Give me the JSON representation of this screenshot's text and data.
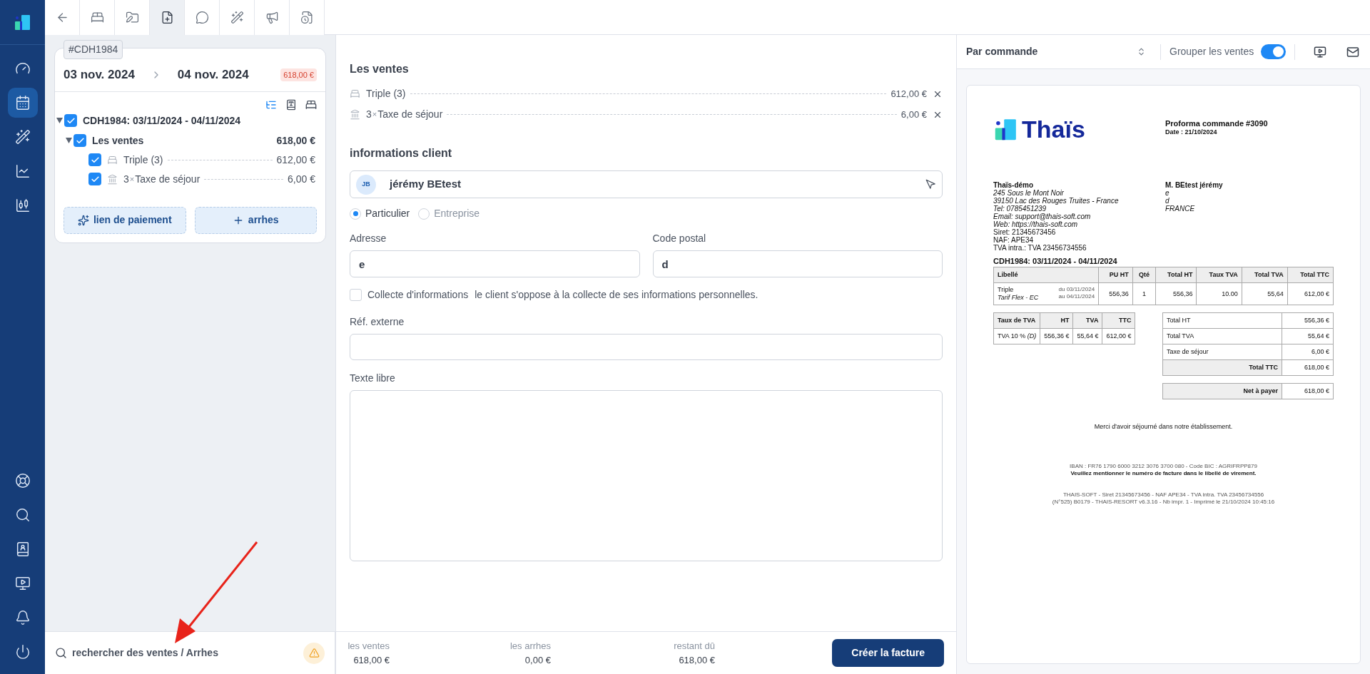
{
  "sidebar": {
    "items": [
      {
        "kind": "gauge",
        "selected": false
      },
      {
        "kind": "calendar",
        "selected": true
      },
      {
        "kind": "wand",
        "selected": false
      },
      {
        "kind": "chart",
        "selected": false
      },
      {
        "kind": "candles",
        "selected": false
      }
    ],
    "bottom_items": [
      {
        "kind": "lifebuoy"
      },
      {
        "kind": "search"
      },
      {
        "kind": "contacts"
      },
      {
        "kind": "monitor"
      },
      {
        "kind": "bell"
      },
      {
        "kind": "power"
      }
    ]
  },
  "tabs": [
    {
      "kind": "back",
      "selected": false
    },
    {
      "kind": "bed",
      "selected": false
    },
    {
      "kind": "folder",
      "selected": false
    },
    {
      "kind": "file-plus",
      "selected": true
    },
    {
      "kind": "message",
      "selected": false
    },
    {
      "kind": "wand",
      "selected": false
    },
    {
      "kind": "megaphone",
      "selected": false
    },
    {
      "kind": "file-clock",
      "selected": false
    }
  ],
  "booking": {
    "reference": "#CDH1984",
    "arrival": "03 nov. 2024",
    "departure": "04 nov. 2024",
    "balance": "618,00 €",
    "tree": {
      "label": "CDH1984: 03/11/2024 - 04/11/2024",
      "checked": true,
      "expanded": true,
      "children": [
        {
          "label": "Les ventes",
          "amount": "618,00 €",
          "checked": true,
          "expanded": true,
          "children": [
            {
              "kind": "room",
              "label": "Triple (3)",
              "amount": "612,00 €",
              "checked": true
            },
            {
              "kind": "tax",
              "quantity": "3",
              "multiplier": "×",
              "label": "Taxe de séjour",
              "amount": "6,00 €",
              "checked": true
            }
          ]
        }
      ]
    },
    "buttons": [
      {
        "kind": "sparkles",
        "label": "lien de paiement"
      },
      {
        "kind": "plus",
        "label": "arrhes"
      }
    ]
  },
  "search": {
    "placeholder": "rechercher des ventes / Arrhes"
  },
  "sales": {
    "title": "Les ventes",
    "items": [
      {
        "kind": "room",
        "label": "Triple (3)",
        "amount": "612,00 €"
      },
      {
        "kind": "tax",
        "quantity": "3",
        "multiplier": "×",
        "label": "Taxe de séjour",
        "amount": "6,00 €"
      }
    ]
  },
  "client": {
    "title": "informations client",
    "initials": "JB",
    "name": "jérémy BEtest",
    "types": [
      {
        "label": "Particulier",
        "selected": true
      },
      {
        "label": "Entreprise",
        "selected": false
      }
    ],
    "address": {
      "label": "Adresse",
      "value": "e"
    },
    "postal_code": {
      "label": "Code postal",
      "value": "d"
    },
    "consent": {
      "label": "Collecte d'informations",
      "description": "le client s'oppose à la collecte de ses informations personnelles.",
      "checked": false
    },
    "external_ref": {
      "label": "Réf. externe"
    },
    "free_text": {
      "label": "Texte libre"
    }
  },
  "totals": [
    {
      "label": "les ventes",
      "value": "618,00 €"
    },
    {
      "label": "les arrhes",
      "value": "0,00 €"
    },
    {
      "label": "restant dû",
      "value": "618,00 €"
    }
  ],
  "create_button": "Créer la facture",
  "preview": {
    "grouping": "Par commande",
    "group_sales": {
      "label": "Grouper les ventes",
      "on": true
    },
    "document": {
      "logo_text": "Thaïs",
      "title": "Proforma commande #3090",
      "date": "Date : 21/10/2024",
      "issuer": {
        "name": "Thaïs-démo",
        "lines": [
          {
            "text": "245 Sous le Mont Noir",
            "italic": true
          },
          {
            "text": "39150 Lac des Rouges Truites - France",
            "italic": true
          },
          {
            "text": "Tel: 0785451239",
            "italic": true
          },
          {
            "text": "Email: support@thais-soft.com",
            "italic": true
          },
          {
            "text": "Web: https://thais-soft.com",
            "italic": true
          },
          {
            "text": "Siret: 21345673456",
            "italic": false
          },
          {
            "text": "NAF: APE34",
            "italic": false
          },
          {
            "text": "TVA intra.: TVA 23456734556",
            "italic": false
          }
        ]
      },
      "recipient": {
        "name": "M. BEtest jérémy",
        "lines": [
          "e",
          "d",
          "FRANCE"
        ]
      },
      "order_title": "CDH1984: 03/11/2024 - 04/11/2024",
      "columns": [
        "Libellé",
        "PU HT",
        "Qté",
        "Total HT",
        "Taux TVA",
        "Total TVA",
        "Total TTC"
      ],
      "rows": [
        {
          "label": "Triple",
          "rate_name": "Tarif Flex - EC",
          "from": "du 03/11/2024",
          "to": "au 04/11/2024",
          "unit_price": "556,36",
          "quantity": "1",
          "total_ht": "556,36",
          "vat_rate": "10.00",
          "total_vat": "55,64",
          "total_ttc": "612,00 €"
        }
      ],
      "vat_columns": [
        "Taux de TVA",
        "HT",
        "TVA",
        "TTC"
      ],
      "vat_rows": [
        [
          "TVA 10 % *(D)*",
          "556,36 €",
          "55,64 €",
          "612,00 €"
        ]
      ],
      "summary": [
        {
          "kind": "line",
          "label": "Total HT",
          "value": "556,36 €"
        },
        {
          "kind": "line",
          "label": "Total TVA",
          "value": "55,64 €"
        },
        {
          "kind": "line",
          "label": "Taxe de séjour",
          "value": "6,00 €"
        },
        {
          "kind": "total",
          "label": "Total TTC",
          "value": "618,00 €"
        }
      ],
      "net": {
        "label": "Net à payer",
        "value": "618,00 €"
      },
      "thanks": "Merci d'avoir séjourné dans notre établissement.",
      "bank": [
        "IBAN : FR76 1790 6000 3212 3076 3700 080 - Code BIC : AGRIFRPP879",
        "Veuillez mentionner le numéro de facture dans le libellé de virement."
      ],
      "legal": [
        "THAIS-SOFT - Siret 21345673456 - NAF APE34 - TVA intra. TVA 23456734556",
        "(N°525) B0179 - THAIS-RESORT v6.3.16 - Nb impr. 1 - Imprimé le 21/10/2024 10:45:16"
      ]
    }
  }
}
